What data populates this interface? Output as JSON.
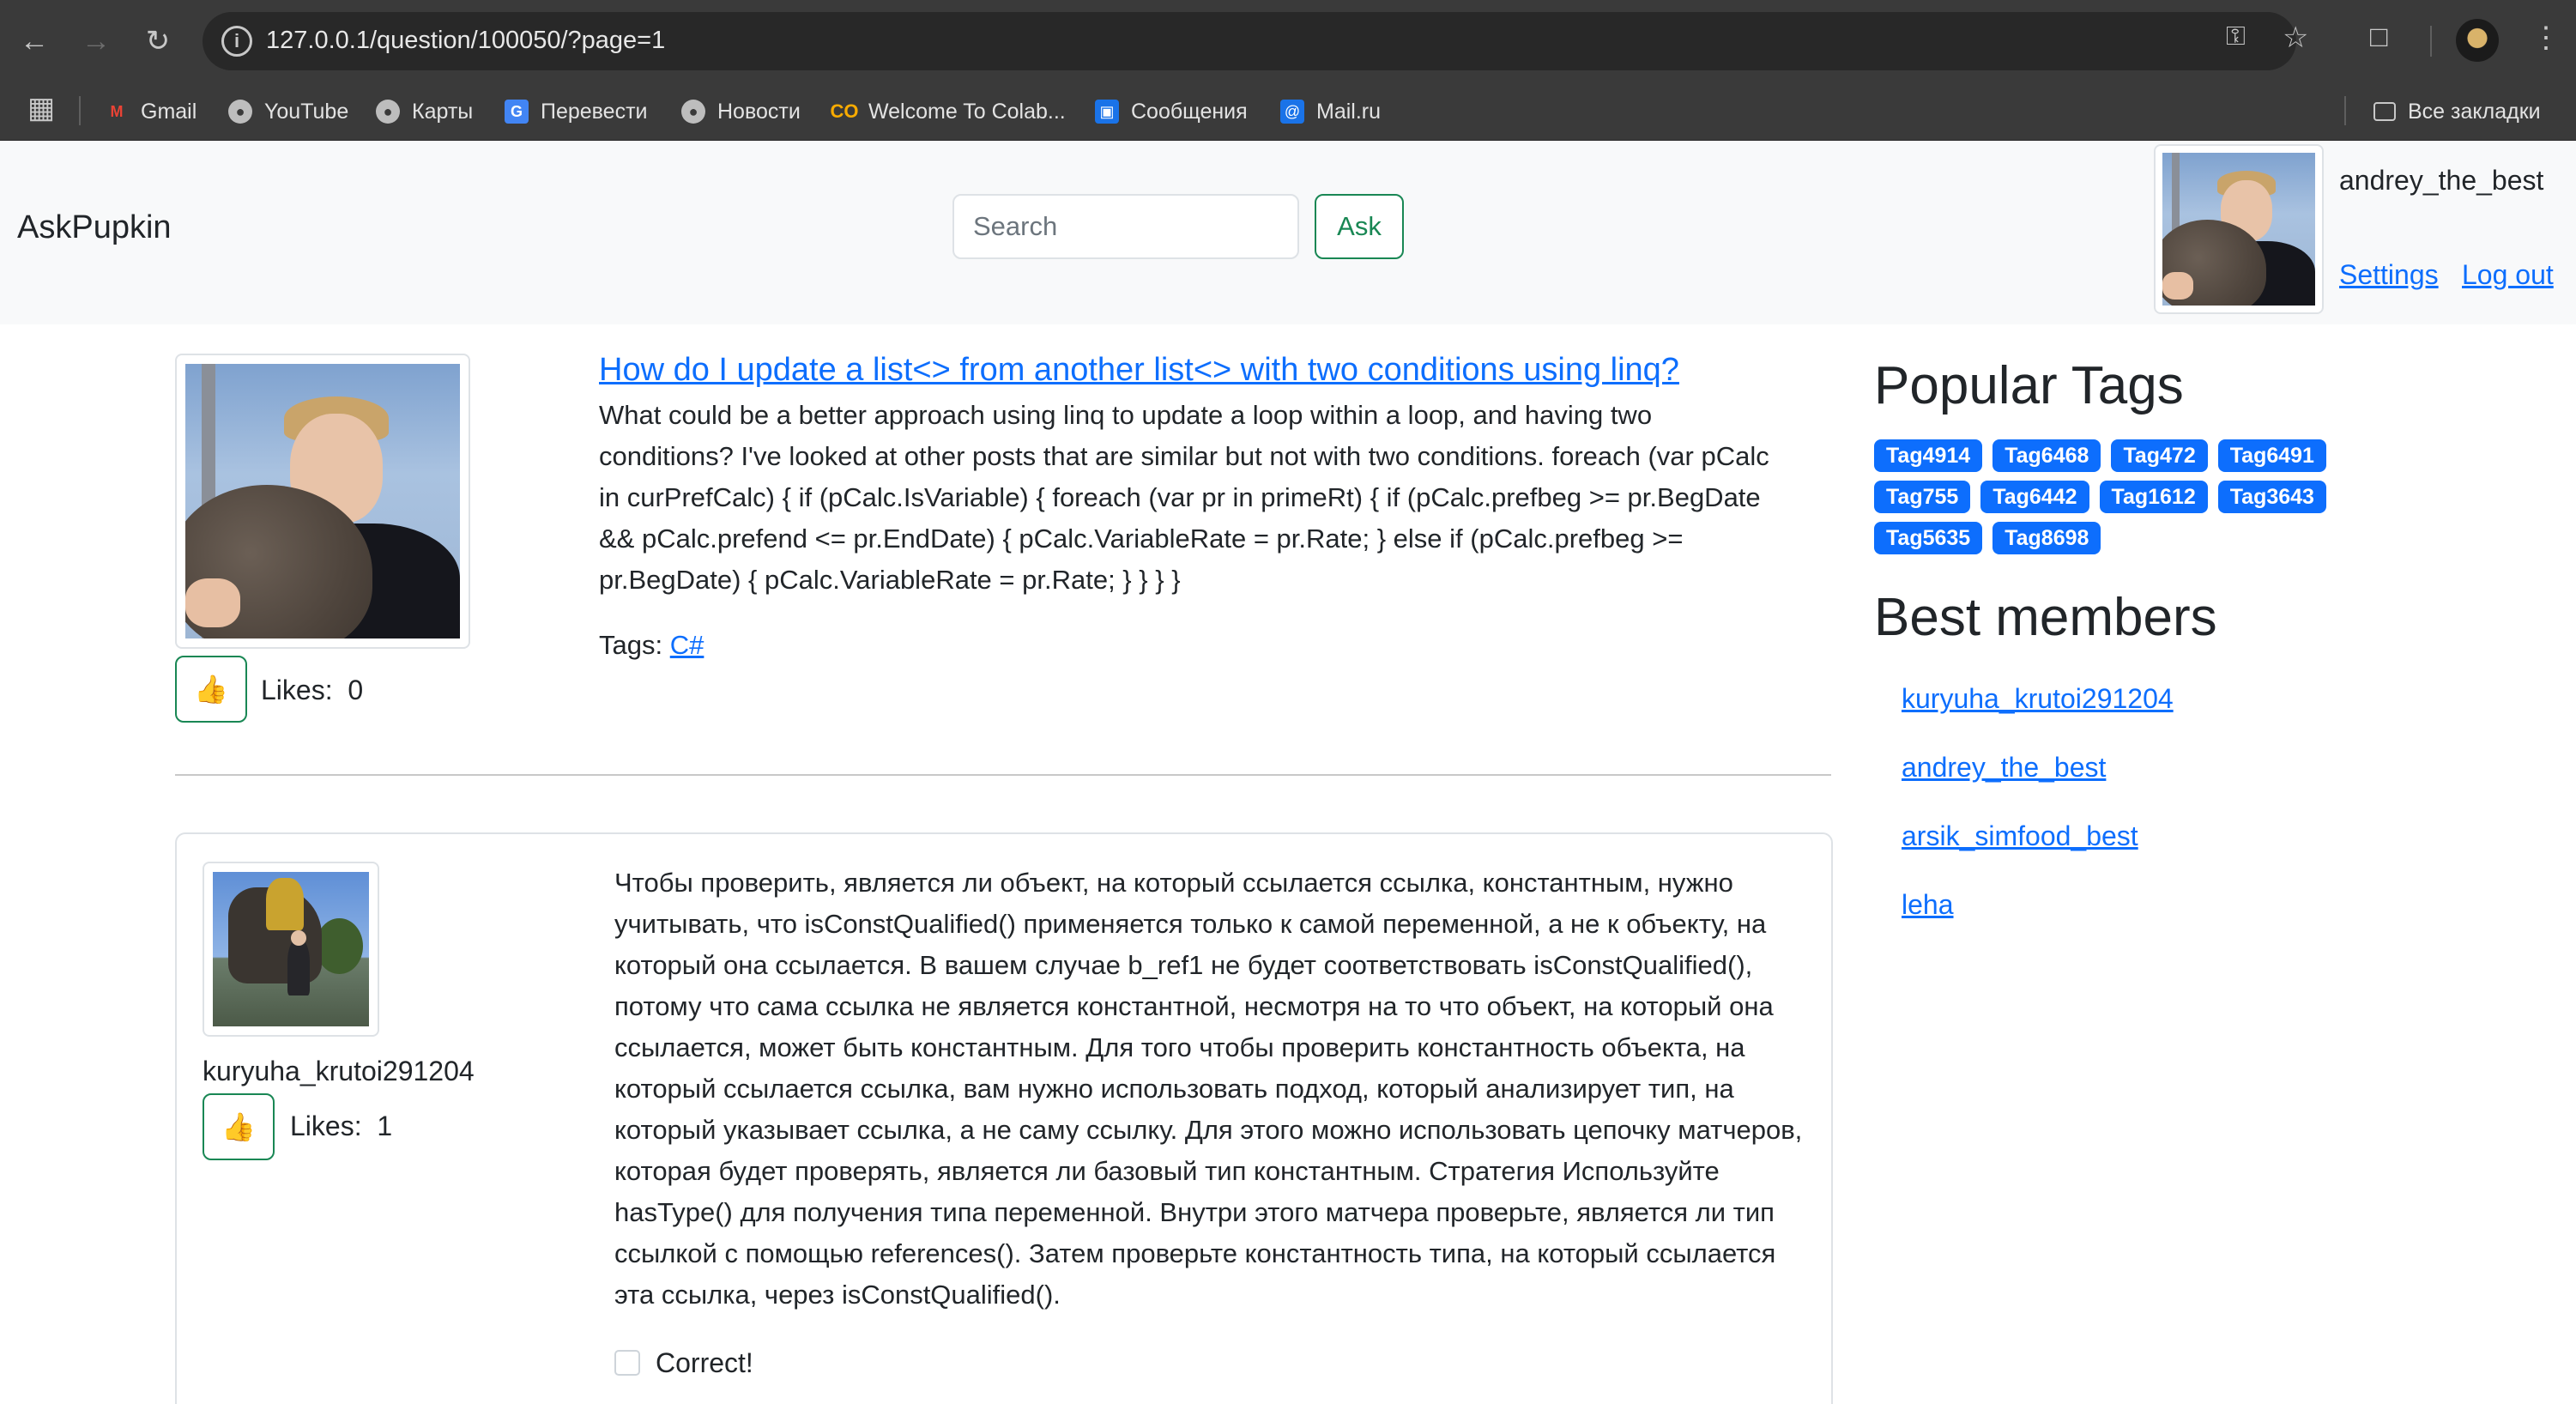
{
  "browser": {
    "url": "127.0.0.1/question/100050/?page=1",
    "bookmarks": [
      {
        "label": "Gmail",
        "icon": "gmail-icon"
      },
      {
        "label": "YouTube",
        "icon": "globe-icon"
      },
      {
        "label": "Карты",
        "icon": "globe-icon"
      },
      {
        "label": "Перевести",
        "icon": "translate-icon"
      },
      {
        "label": "Новости",
        "icon": "globe-icon"
      },
      {
        "label": "Welcome To Colab...",
        "icon": "colab-icon"
      },
      {
        "label": "Сообщения",
        "icon": "messages-icon"
      },
      {
        "label": "Mail.ru",
        "icon": "mail-icon"
      }
    ],
    "all_bookmarks": "Все закладки"
  },
  "header": {
    "brand": "AskPupkin",
    "search_placeholder": "Search",
    "ask_label": "Ask",
    "username": "andrey_the_best",
    "settings_label": "Settings",
    "logout_label": "Log out"
  },
  "question": {
    "title": "How do I update a list<> from another list<> with two conditions using linq?",
    "body": "What could be a better approach using linq to update a loop within a loop, and having two conditions? I've looked at other posts that are similar but not with two conditions. foreach (var pCalc in curPrefCalc) { if (pCalc.IsVariable) { foreach (var pr in primeRt) { if (pCalc.prefbeg >= pr.BegDate && pCalc.prefend <= pr.EndDate) { pCalc.VariableRate = pr.Rate; } else if (pCalc.prefbeg >= pr.BegDate) { pCalc.VariableRate = pr.Rate; } } } }",
    "likes_label": "Likes:",
    "likes": "0",
    "tags_label": "Tags:",
    "tag": "C#",
    "like_icon": "👍"
  },
  "answer": {
    "author": "kuryuha_krutoi291204",
    "likes_label": "Likes:",
    "likes": "1",
    "like_icon": "👍",
    "body": "Чтобы проверить, является ли объект, на который ссылается ссылка, константным, нужно учитывать, что isConstQualified() применяется только к самой переменной, а не к объекту, на который она ссылается. В вашем случае b_ref1 не будет соответствовать isConstQualified(), потому что сама ссылка не является константной, несмотря на то что объект, на который она ссылается, может быть константным. Для того чтобы проверить константность объекта, на который ссылается ссылка, вам нужно использовать подход, который анализирует тип, на который указывает ссылка, а не саму ссылку. Для этого можно использовать цепочку матчеров, которая будет проверять, является ли базовый тип константным. Стратегия Используйте hasType() для получения типа переменной. Внутри этого матчера проверьте, является ли тип ссылкой с помощью references(). Затем проверьте константность типа, на который ссылается эта ссылка, через isConstQualified().",
    "correct_label": "Correct!"
  },
  "sidebar": {
    "popular_tags_title": "Popular Tags",
    "tags": [
      "Tag4914",
      "Tag6468",
      "Tag472",
      "Tag6491",
      "Tag755",
      "Tag6442",
      "Tag1612",
      "Tag3643",
      "Tag5635",
      "Tag8698"
    ],
    "best_members_title": "Best members",
    "members": [
      "kuryuha_krutoi291204",
      "andrey_the_best",
      "arsik_simfood_best",
      "leha"
    ]
  },
  "colors": {
    "link": "#0d6efd",
    "success": "#198754",
    "chrome_bg": "#3a3a3a",
    "header_bg": "#f8f9fa"
  }
}
